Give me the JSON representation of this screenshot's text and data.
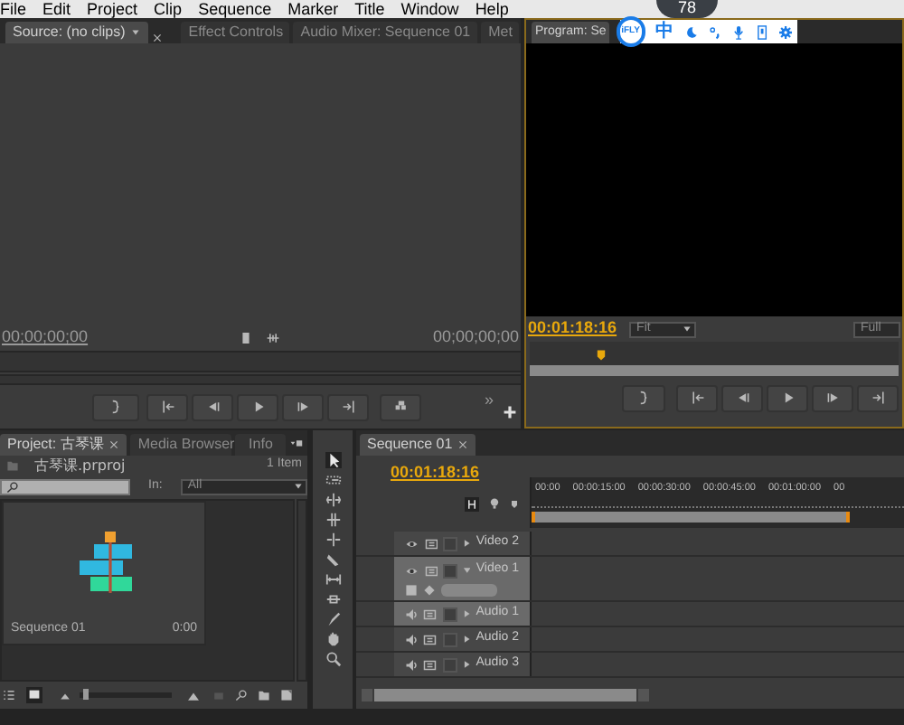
{
  "menu": [
    "File",
    "Edit",
    "Project",
    "Clip",
    "Sequence",
    "Marker",
    "Title",
    "Window",
    "Help"
  ],
  "gauge": {
    "value": "78"
  },
  "ime_toolbar": {
    "logo": "iFLY",
    "mode": "中"
  },
  "source_panel": {
    "tabs": [
      {
        "label": "Source: (no clips)",
        "selected": true
      },
      {
        "label": "Effect Controls",
        "selected": false
      },
      {
        "label": "Audio Mixer: Sequence 01",
        "selected": false
      },
      {
        "label": "Met",
        "selected": false
      }
    ],
    "timecode_in": "00;00;00;00",
    "timecode_out": "00;00;00;00",
    "more": "»"
  },
  "program_panel": {
    "tab": {
      "label": "Program: Se",
      "selected": true
    },
    "timecode": "00:01:18:16",
    "zoom": "Fit",
    "quality": "Full"
  },
  "project_panel": {
    "tabs": [
      {
        "label": "Project: 古琴课",
        "selected": true
      },
      {
        "label": "Media Browser",
        "selected": false
      },
      {
        "label": "Info",
        "selected": false
      }
    ],
    "file": "古琴课.prproj",
    "item_count": "1 Item",
    "in_label": "In:",
    "in_value": "All",
    "items": [
      {
        "name": "Sequence 01",
        "duration": "0:00"
      }
    ],
    "zoom_slider": {
      "level": 0.04
    }
  },
  "timeline": {
    "tab": {
      "label": "Sequence 01",
      "selected": true
    },
    "timecode": "00:01:18:16",
    "ruler": [
      "00:00",
      "00:00:15:00",
      "00:00:30:00",
      "00:00:45:00",
      "00:01:00:00",
      "00"
    ],
    "tracks": [
      {
        "name": "Video 2",
        "kind": "video",
        "expanded": false,
        "selected": false
      },
      {
        "name": "Video 1",
        "kind": "video",
        "expanded": true,
        "selected": true
      },
      {
        "name": "Audio 1",
        "kind": "audio",
        "expanded": false,
        "selected": true
      },
      {
        "name": "Audio 2",
        "kind": "audio",
        "expanded": false,
        "selected": false
      },
      {
        "name": "Audio 3",
        "kind": "audio",
        "expanded": false,
        "selected": false
      }
    ]
  }
}
